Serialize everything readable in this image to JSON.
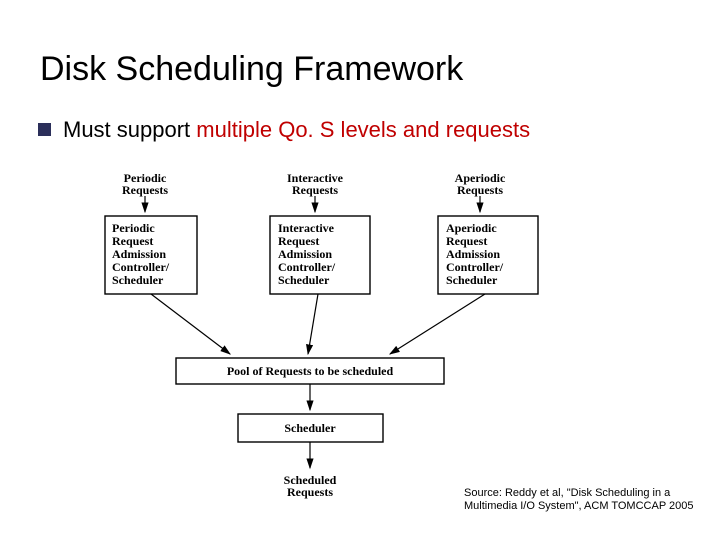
{
  "slide": {
    "title": "Disk Scheduling Framework",
    "bullet": {
      "prefix": "Must support ",
      "emphasis": "multiple Qo. S levels and requests"
    },
    "source": "Source: Reddy et al, \"Disk Scheduling in a Multimedia I/O System\",  ACM TOMCCAP 2005"
  },
  "diagram": {
    "labels": {
      "periodic": "Periodic Requests",
      "interactive": "Interactive Requests",
      "aperiodic": "Aperiodic Requests",
      "pool": "Pool of Requests to be scheduled",
      "scheduler": "Scheduler",
      "scheduled": "Scheduled Requests"
    },
    "boxes": {
      "periodic": [
        "Periodic",
        "Request",
        "Admission",
        "Controller/",
        "Scheduler"
      ],
      "interactive": [
        "Interactive",
        "Request",
        "Admission",
        "Controller/",
        "Scheduler"
      ],
      "aperiodic": [
        "Aperiodic",
        "Request",
        "Admission",
        "Controller/",
        "Scheduler"
      ]
    }
  }
}
